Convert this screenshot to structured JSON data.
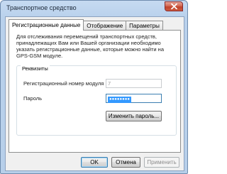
{
  "window": {
    "title": "Транспортное средство",
    "close_icon": "close-icon"
  },
  "tabs": [
    {
      "label": "Регистрационные данные",
      "active": true
    },
    {
      "label": "Отображение",
      "active": false
    },
    {
      "label": "Параметры",
      "active": false
    }
  ],
  "registration": {
    "description": "Для отслеживания перемещений транспортных средств, принадлежащих Вам или Вашей организации необходимо указать регистрационные данные, которые можно найти на GPS-GSM модуле.",
    "group_title": "Реквизиты",
    "module_number_label": "Регистрационный номер модуля",
    "module_number_value": "7",
    "password_label": "Пароль",
    "password_value": "●●●●●●●●",
    "change_password_label": "Изменить пароль..."
  },
  "buttons": {
    "ok": "OK",
    "cancel": "Отмена",
    "apply": "Применить"
  },
  "colors": {
    "frame": "#b9d1ec",
    "close": "#c7462f",
    "selection": "#3399ff"
  }
}
